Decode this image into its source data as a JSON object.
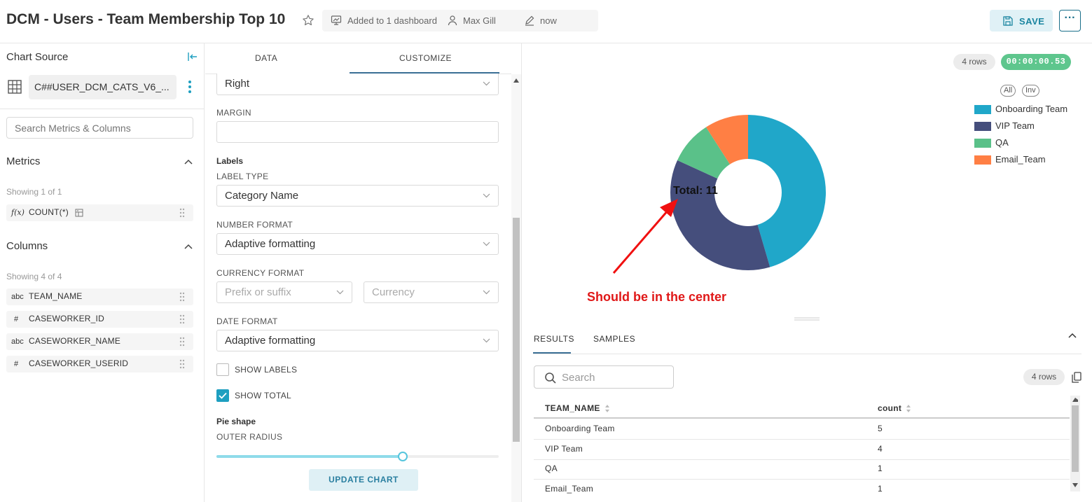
{
  "header": {
    "title": "DCM - Users - Team Membership Top 10",
    "dashboards": "Added to 1 dashboard",
    "owner": "Max Gill",
    "modified": "now",
    "save_label": "SAVE",
    "more_label": "···"
  },
  "left": {
    "chart_source_title": "Chart Source",
    "source_name": "C##USER_DCM_CATS_V6_...",
    "search_placeholder": "Search Metrics & Columns",
    "metrics_title": "Metrics",
    "metrics_showing": "Showing 1 of 1",
    "metrics": [
      {
        "type": "f(x)",
        "name": "COUNT(*)"
      }
    ],
    "columns_title": "Columns",
    "columns_showing": "Showing 4 of 4",
    "columns": [
      {
        "type": "abc",
        "name": "TEAM_NAME"
      },
      {
        "type": "#",
        "name": "CASEWORKER_ID"
      },
      {
        "type": "abc",
        "name": "CASEWORKER_NAME"
      },
      {
        "type": "#",
        "name": "CASEWORKER_USERID"
      }
    ]
  },
  "customize": {
    "tab_data": "DATA",
    "tab_customize": "CUSTOMIZE",
    "legend_position_value": "Right",
    "margin_label": "MARGIN",
    "margin_value": "",
    "labels_heading": "Labels",
    "label_type_label": "LABEL TYPE",
    "label_type_value": "Category Name",
    "number_format_label": "NUMBER FORMAT",
    "number_format_value": "Adaptive formatting",
    "currency_format_label": "CURRENCY FORMAT",
    "currency_prefix_placeholder": "Prefix or suffix",
    "currency_placeholder": "Currency",
    "date_format_label": "DATE FORMAT",
    "date_format_value": "Adaptive formatting",
    "show_labels_label": "SHOW LABELS",
    "show_labels_checked": false,
    "show_total_label": "SHOW TOTAL",
    "show_total_checked": true,
    "pie_shape_heading": "Pie shape",
    "outer_radius_label": "OUTER RADIUS",
    "outer_radius_fraction": 0.66,
    "update_label": "UPDATE CHART"
  },
  "chart_panel": {
    "rows_badge": "4 rows",
    "time_badge": "00:00:00.53",
    "legend_all": "All",
    "legend_inv": "Inv",
    "total_label": "Total: 11",
    "annotation": "Should be in the center"
  },
  "chart_data": {
    "type": "pie",
    "categories": [
      "Onboarding Team",
      "VIP Team",
      "QA",
      "Email_Team"
    ],
    "values": [
      5,
      4,
      1,
      1
    ],
    "colors": [
      "#20a7c9",
      "#454e7c",
      "#5ac189",
      "#ff7f44"
    ],
    "donut": true,
    "show_total": true,
    "legend_position": "right"
  },
  "results": {
    "tab_results": "RESULTS",
    "tab_samples": "SAMPLES",
    "search_placeholder": "Search",
    "rows_badge": "4 rows",
    "columns": [
      "TEAM_NAME",
      "count"
    ],
    "rows": [
      [
        "Onboarding Team",
        "5"
      ],
      [
        "VIP Team",
        "4"
      ],
      [
        "QA",
        "1"
      ],
      [
        "Email_Team",
        "1"
      ]
    ]
  }
}
